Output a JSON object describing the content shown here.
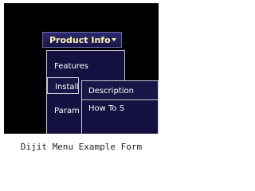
{
  "menubar": {
    "label": "Product Info"
  },
  "submenu": {
    "items": [
      {
        "label": "Features"
      },
      {
        "label": "Install"
      },
      {
        "label": "Param"
      }
    ]
  },
  "submenu2": {
    "items": [
      {
        "label": "Description"
      },
      {
        "label": "How To S"
      }
    ]
  },
  "caption": "Dijit Menu Example Form",
  "colors": {
    "menu_bg": "#141040",
    "menubar_text": "#fff5b0",
    "border": "#c8c8d8",
    "screen_bg": "#000000"
  },
  "icons": {
    "menubar_arrow": "chevron-down-icon"
  }
}
